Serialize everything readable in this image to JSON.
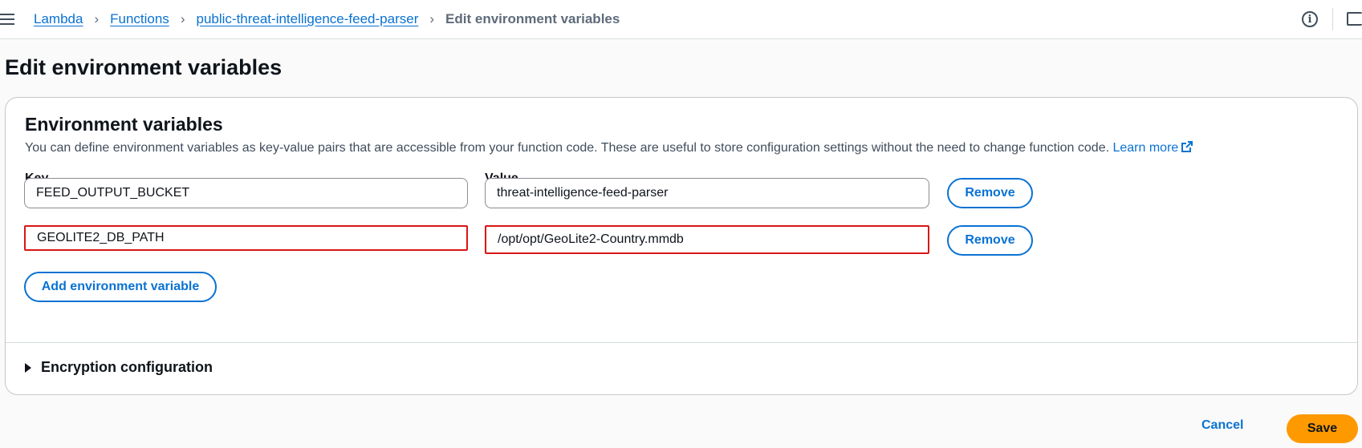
{
  "breadcrumb": {
    "items": [
      "Lambda",
      "Functions",
      "public-threat-intelligence-feed-parser"
    ],
    "current": "Edit environment variables"
  },
  "page": {
    "title": "Edit environment variables"
  },
  "env_panel": {
    "title": "Environment variables",
    "description": "You can define environment variables as key-value pairs that are accessible from your function code. These are useful to store configuration settings without the need to change function code.",
    "learn_more": "Learn more",
    "key_header": "Key",
    "value_header": "Value",
    "rows": [
      {
        "key": "FEED_OUTPUT_BUCKET",
        "value": "threat-intelligence-feed-parser",
        "remove_label": "Remove"
      },
      {
        "key": "GEOLITE2_DB_PATH",
        "value": "/opt/opt/GeoLite2-Country.mmdb",
        "remove_label": "Remove"
      }
    ],
    "add_label": "Add environment variable"
  },
  "encryption": {
    "label": "Encryption configuration"
  },
  "footer": {
    "cancel_label": "Cancel",
    "save_label": "Save"
  },
  "colors": {
    "link": "#0972d3",
    "primary": "#ff9900",
    "highlight": "#d91515"
  },
  "icons": [
    "menu-icon",
    "info-icon",
    "feedback-icon",
    "external-link-icon",
    "caret-right-icon"
  ]
}
